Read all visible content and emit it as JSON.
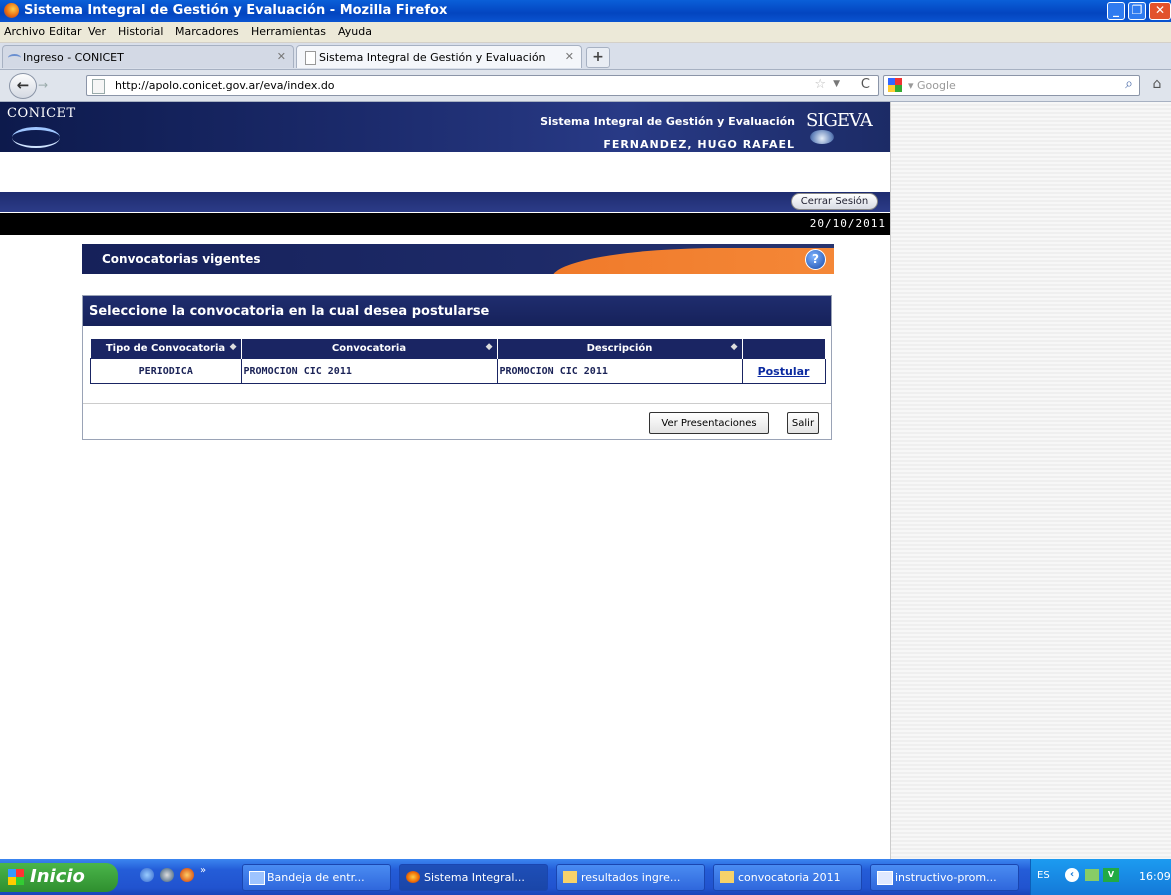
{
  "window": {
    "title": "Sistema Integral de Gestión y Evaluación - Mozilla Firefox"
  },
  "menu": [
    "Archivo",
    "Editar",
    "Ver",
    "Historial",
    "Marcadores",
    "Herramientas",
    "Ayuda"
  ],
  "tabs": [
    {
      "label": "Ingreso - CONICET"
    },
    {
      "label": "Sistema Integral de Gestión y Evaluación"
    }
  ],
  "nav": {
    "url": "http://apolo.conicet.gov.ar/eva/index.do",
    "search_placeholder": "Google"
  },
  "site": {
    "logo": "CONICET",
    "system_name": "Sistema Integral de Gestión y Evaluación",
    "user": "FERNANDEZ, HUGO RAFAEL",
    "sigeva_logo": "SIGEVA",
    "logout": "Cerrar Sesión",
    "date": "20/10/2011"
  },
  "page": {
    "title": "Convocatorias vigentes",
    "panel_title": "Seleccione la convocatoria en la cual desea postularse",
    "table": {
      "headers": [
        "Tipo de Convocatoria",
        "Convocatoria",
        "Descripción",
        ""
      ],
      "rows": [
        {
          "tipo": "PERIODICA",
          "convocatoria": "PROMOCION CIC 2011",
          "descripcion": "PROMOCION CIC 2011",
          "action": "Postular"
        }
      ]
    },
    "buttons": {
      "ver_presentaciones": "Ver Presentaciones",
      "salir": "Salir"
    }
  },
  "taskbar": {
    "start": "Inicio",
    "tasks": [
      "Bandeja de entr...",
      "Sistema Integral...",
      "resultados ingre...",
      "convocatoria 2011",
      "instructivo-prom..."
    ],
    "lang": "ES",
    "time": "16:09"
  },
  "colors": {
    "header_navy": "#1a2563",
    "accent_orange": "#f07a2a",
    "link_blue": "#0b2aa0"
  }
}
